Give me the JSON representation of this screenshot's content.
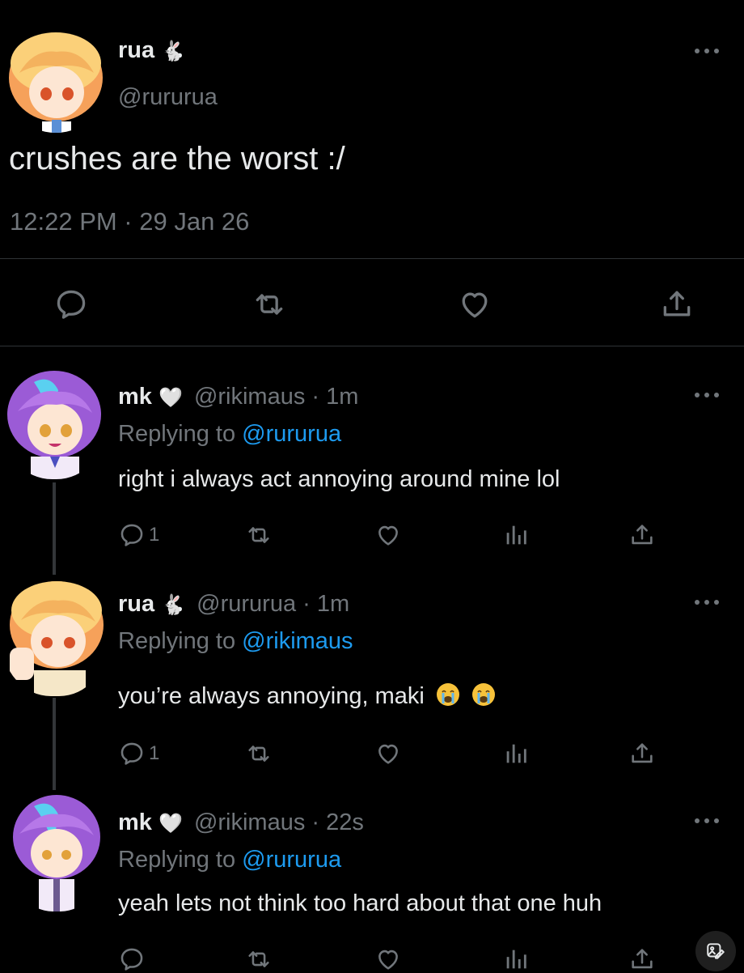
{
  "main_tweet": {
    "display_name": "rua",
    "name_emoji": "🐇",
    "handle": "@rururua",
    "text": "crushes are the worst :/",
    "timestamp": "12:22 PM · 29 Jan 26"
  },
  "replies": [
    {
      "display_name": "mk",
      "name_emoji": "🤍",
      "handle_time": "@rikimaus · 1m",
      "replying_label": "Replying to",
      "replying_to": "@rururua",
      "text": "right i always act annoying around mine lol",
      "reply_count": "1"
    },
    {
      "display_name": "rua",
      "name_emoji": "🐇",
      "handle_time": "@rururua · 1m",
      "replying_label": "Replying to",
      "replying_to": "@rikimaus",
      "text": "you’re always annoying, maki",
      "reply_count": "1"
    },
    {
      "display_name": "mk",
      "name_emoji": "🤍",
      "handle_time": "@rikimaus · 22s",
      "replying_label": "Replying to",
      "replying_to": "@rururua",
      "text": "yeah lets not think too hard about that one huh",
      "reply_count": ""
    }
  ],
  "icons": [
    "more-icon",
    "reply-icon",
    "retweet-icon",
    "like-icon",
    "share-icon",
    "views-icon",
    "crying-emoji-icon",
    "image-edit-icon"
  ],
  "colors": {
    "background": "#000000",
    "text": "#e7e9ea",
    "muted": "#71767b",
    "link": "#1d9bf0",
    "divider": "#2f3336"
  }
}
